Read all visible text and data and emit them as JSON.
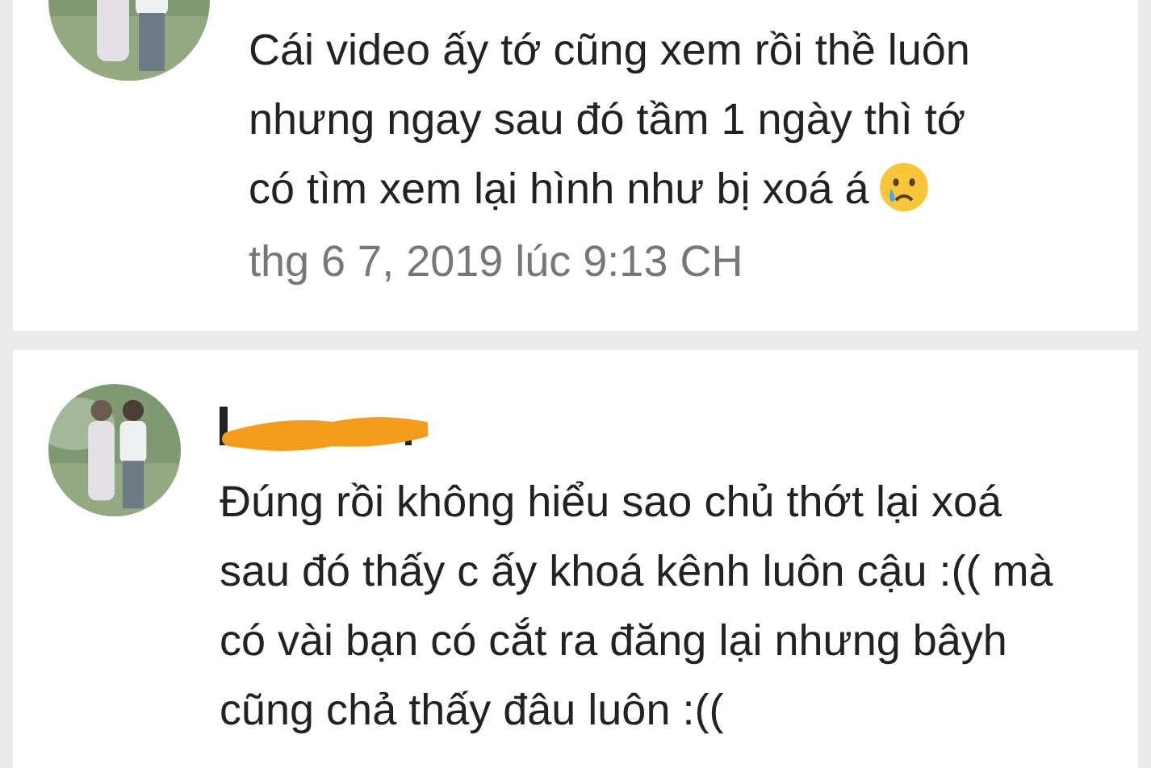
{
  "comments": [
    {
      "text": "Cái video ấy tớ cũng xem rồi thề luôn nhưng ngay sau đó tầm 1 ngày thì tớ có tìm xem lại hình như bị xoá á",
      "crying_icon": true,
      "time": "thg 6 7, 2019 lúc 9:13 CH"
    },
    {
      "text": "Đúng rồi không hiểu sao chủ thớt lại xoá sau đó thấy c ấy khoá kênh luôn cậu :(( mà có vài bạn có cắt ra đăng lại nhưng bâyh cũng chả thấy đâu luôn :((",
      "name_redacted": true
    }
  ]
}
